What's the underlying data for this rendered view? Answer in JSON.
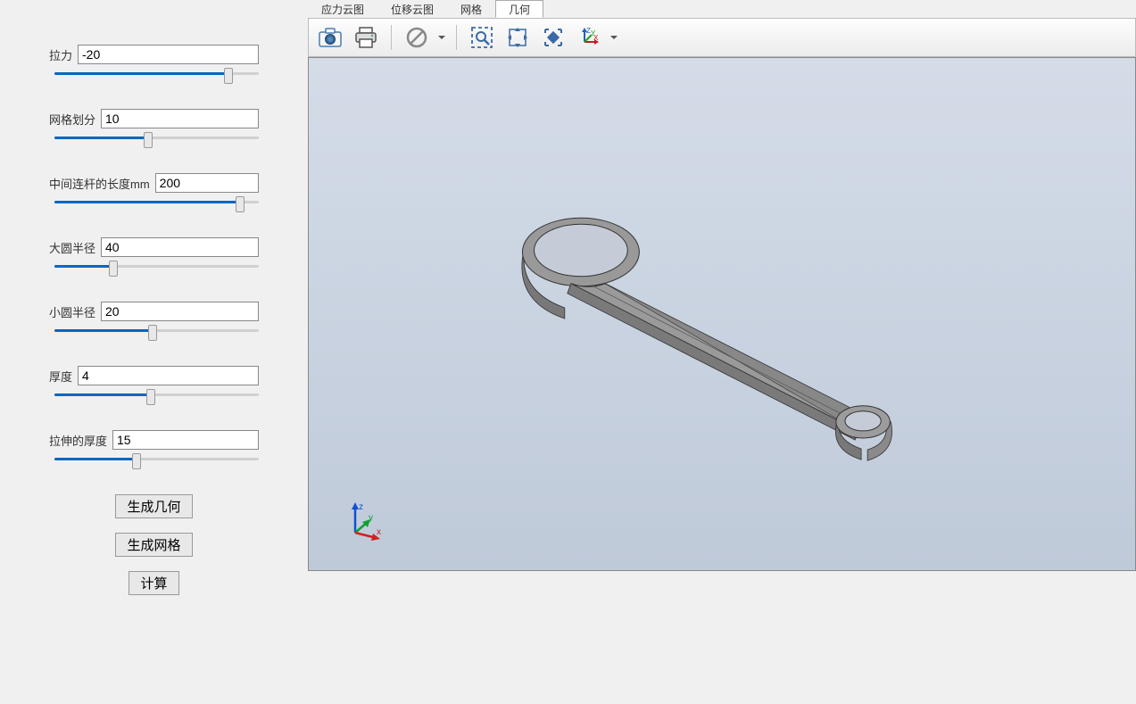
{
  "params": [
    {
      "label": "拉力",
      "value": "-20",
      "fill": 85
    },
    {
      "label": "网格划分",
      "value": "10",
      "fill": 46
    },
    {
      "label": "中间连杆的长度mm",
      "value": "200",
      "fill": 91
    },
    {
      "label": "大圆半径",
      "value": "40",
      "fill": 29
    },
    {
      "label": "小圆半径",
      "value": "20",
      "fill": 48
    },
    {
      "label": "厚度",
      "value": "4",
      "fill": 47
    },
    {
      "label": "拉伸的厚度",
      "value": "15",
      "fill": 40
    }
  ],
  "buttons": {
    "gen_geom": "生成几何",
    "gen_mesh": "生成网格",
    "compute": "计算"
  },
  "tabs": [
    {
      "label": "应力云图",
      "active": false
    },
    {
      "label": "位移云图",
      "active": false
    },
    {
      "label": "网格",
      "active": false
    },
    {
      "label": "几何",
      "active": true
    }
  ],
  "axis": {
    "x": "x",
    "y": "y",
    "z": "z"
  },
  "toolbar_axis": {
    "x": "X",
    "y": "Y",
    "z": "Z"
  }
}
